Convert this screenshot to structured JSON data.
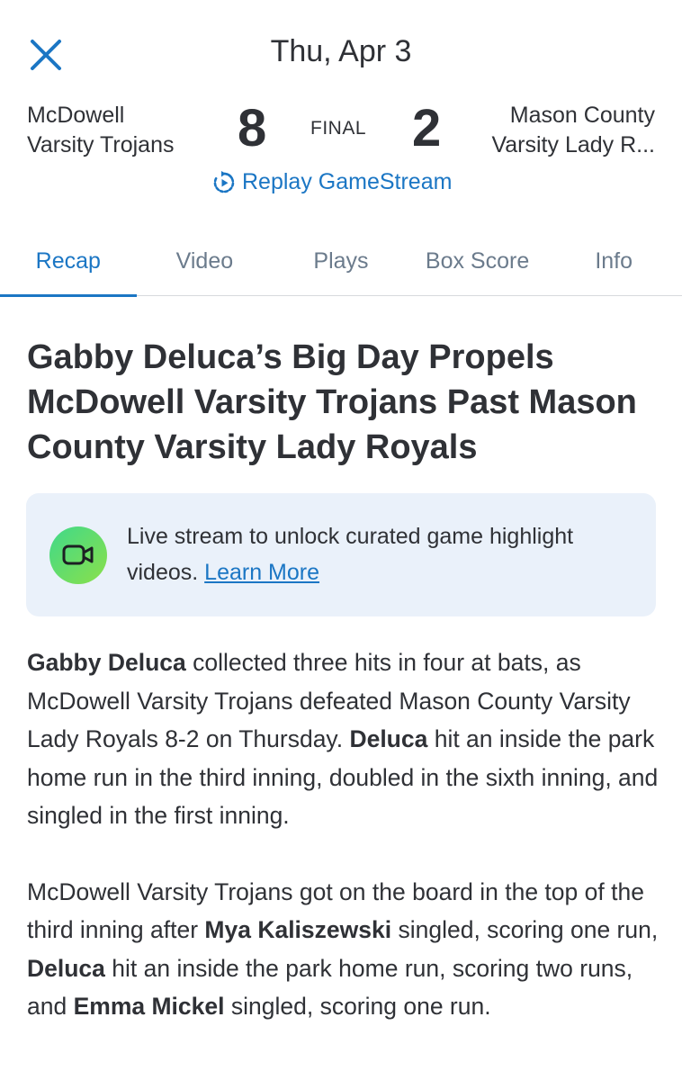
{
  "header": {
    "date": "Thu, Apr 3",
    "close_icon": "close-icon"
  },
  "scoreboard": {
    "home_team": {
      "line1": "McDowell",
      "line2": "Varsity Trojans",
      "score": "8"
    },
    "away_team": {
      "line1": "Mason County",
      "line2": "Varsity Lady R...",
      "score": "2"
    },
    "status": "FINAL",
    "replay_label": "Replay GameStream",
    "replay_icon": "replay-icon"
  },
  "tabs": [
    {
      "label": "Recap",
      "active": true
    },
    {
      "label": "Video",
      "active": false
    },
    {
      "label": "Plays",
      "active": false
    },
    {
      "label": "Box Score",
      "active": false
    },
    {
      "label": "Info",
      "active": false
    }
  ],
  "headline": "Gabby Deluca’s Big Day Propels McDowell Varsity Trojans Past Mason County Varsity Lady Royals",
  "promo": {
    "icon": "video-camera-icon",
    "text": "Live stream to unlock curated game highlight videos.",
    "link": "Learn More"
  },
  "article": {
    "p1": {
      "s1": "Gabby Deluca",
      "s2": " collected three hits in four at bats, as McDowell Varsity Trojans defeated Mason County Varsity Lady Royals 8-2 on Thursday. ",
      "s3": "Deluca",
      "s4": " hit an inside the park home run in the third inning, doubled in the sixth inning, and singled in the first inning."
    },
    "p2": {
      "s1": "McDowell Varsity Trojans got on the board in the top of the third inning after ",
      "s2": "Mya Kaliszewski",
      "s3": " singled, scoring one run, ",
      "s4": "Deluca",
      "s5": " hit an inside the park home run, scoring two runs, and ",
      "s6": "Emma Mickel",
      "s7": " singled, scoring one run."
    }
  },
  "colors": {
    "accent": "#1b76c4",
    "text": "#2f3136",
    "tab_inactive": "#6b7b8c",
    "promo_bg": "#eaf1fa"
  }
}
